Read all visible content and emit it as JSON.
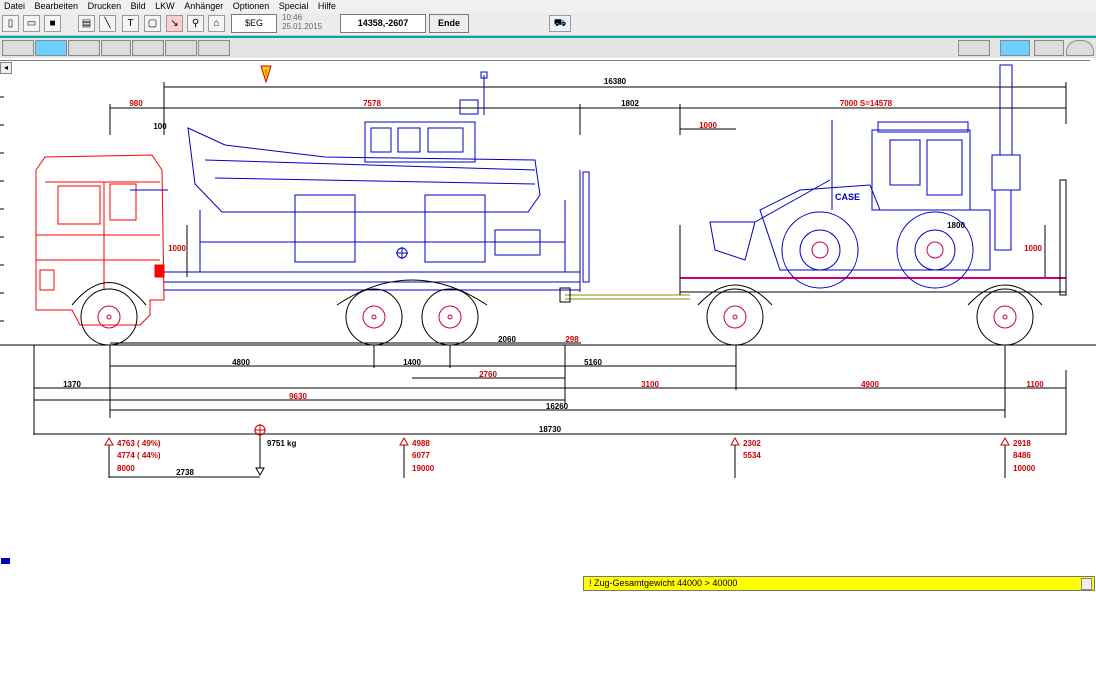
{
  "menu": [
    "Datei",
    "Bearbeiten",
    "Drucken",
    "Bild",
    "LKW",
    "Anhänger",
    "Optionen",
    "Special",
    "Hilfe"
  ],
  "toolbar": {
    "icons": [
      "new-file-icon",
      "open-folder-icon",
      "save-icon",
      "print-icon",
      "line-icon",
      "text-icon",
      "rectangle-icon",
      "measure-icon",
      "search-icon",
      "picture-icon"
    ],
    "mode_label": "$EG",
    "time": "10:46",
    "date": "25.01.2015",
    "coords": "14358,-2607",
    "end_label": "Ende"
  },
  "dimensions": {
    "total_top": "16380",
    "d980": "980",
    "d7578": "7578",
    "d1802": "1802",
    "d7000": "7000  S=14578",
    "d100": "100",
    "d1000_left": "1000",
    "d1000_trailer": "1000",
    "d1000_right": "1000",
    "d1800": "1800",
    "d4800": "4800",
    "d1400": "1400",
    "d2060": "2060",
    "d298": "298",
    "d2760": "2760",
    "d5160": "5160",
    "d1370": "1370",
    "d3100": "3100",
    "d4900": "4900",
    "d1100": "1100",
    "d9630": "9630",
    "d16260": "16260",
    "d18730": "18730",
    "d2738": "2738"
  },
  "axle_loads": {
    "front": [
      "4763 ( 49%)",
      "4774 ( 44%)",
      "8000"
    ],
    "center_weight": "9751 kg",
    "rear": [
      "4988",
      "6077",
      "19000"
    ],
    "trailer1": [
      "2302",
      "5534"
    ],
    "trailer2": [
      "2918",
      "8486",
      "10000"
    ]
  },
  "status": {
    "message": "! Zug-Gesamtgewicht  44000 >  40000"
  },
  "colors": {
    "truck": "#ff0000",
    "vehicle": "#0000c8",
    "wheel": "#cc0044",
    "dim_black": "#000000",
    "dim_red": "#d40000",
    "status_bg": "#ffff00",
    "accent": "#00a9a5"
  }
}
